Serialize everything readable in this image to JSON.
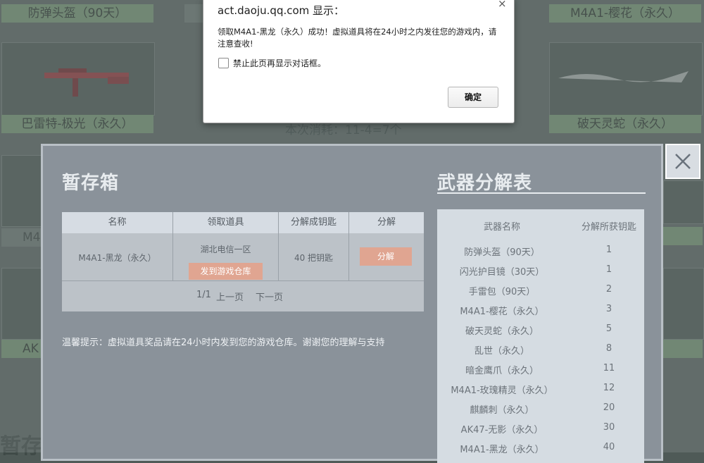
{
  "background": {
    "labels": [
      "防弹头盔（90天）",
      "M4A1-樱花（永久）",
      "巴雷特-极光（永久）",
      "破天灵蛇（永久）",
      "M4",
      "AK",
      "暂存"
    ],
    "cost_text": "本次消耗：11-4=7个"
  },
  "panel": {
    "left_title": "暂存箱",
    "right_title": "武器分解表",
    "close_icon": "close-icon",
    "table": {
      "headers": [
        "名称",
        "领取道具",
        "分解成钥匙",
        "分解"
      ],
      "row": {
        "name": "M4A1-黑龙（永久）",
        "server": "湖北电信一区",
        "send_button": "发到游戏仓库",
        "keys": "40 把钥匙",
        "decompose_button": "分解"
      },
      "pager": {
        "page": "1/1",
        "prev": "上一页",
        "next": "下一页"
      }
    },
    "tip": "温馨提示：虚拟道具奖品请在24小时内发到您的游戏仓库。谢谢您的理解与支持",
    "decompose_table": {
      "headers": [
        "武器名称",
        "分解所获钥匙"
      ],
      "rows": [
        {
          "name": "防弹头盔（90天）",
          "keys": "1"
        },
        {
          "name": "闪光护目镜（30天）",
          "keys": "1"
        },
        {
          "name": "手雷包（90天）",
          "keys": "2"
        },
        {
          "name": "M4A1-樱花（永久）",
          "keys": "3"
        },
        {
          "name": "破天灵蛇（永久）",
          "keys": "5"
        },
        {
          "name": "乱世（永久）",
          "keys": "8"
        },
        {
          "name": "暗金鹰爪（永久）",
          "keys": "11"
        },
        {
          "name": "M4A1-玫瑰精灵（永久）",
          "keys": "12"
        },
        {
          "name": "麒麟刺（永久）",
          "keys": "20"
        },
        {
          "name": "AK47-无影（永久）",
          "keys": "30"
        },
        {
          "name": "M4A1-黑龙（永久）",
          "keys": "40"
        }
      ]
    }
  },
  "dialog": {
    "title": "act.daoju.qq.com 显示：",
    "close": "×",
    "message": "领取M4A1-黑龙（永久）成功！虚拟道具将在24小时之内发往您的游戏内，请注意查收!",
    "checkbox_label": "禁止此页再显示对话框。",
    "ok": "确定"
  }
}
